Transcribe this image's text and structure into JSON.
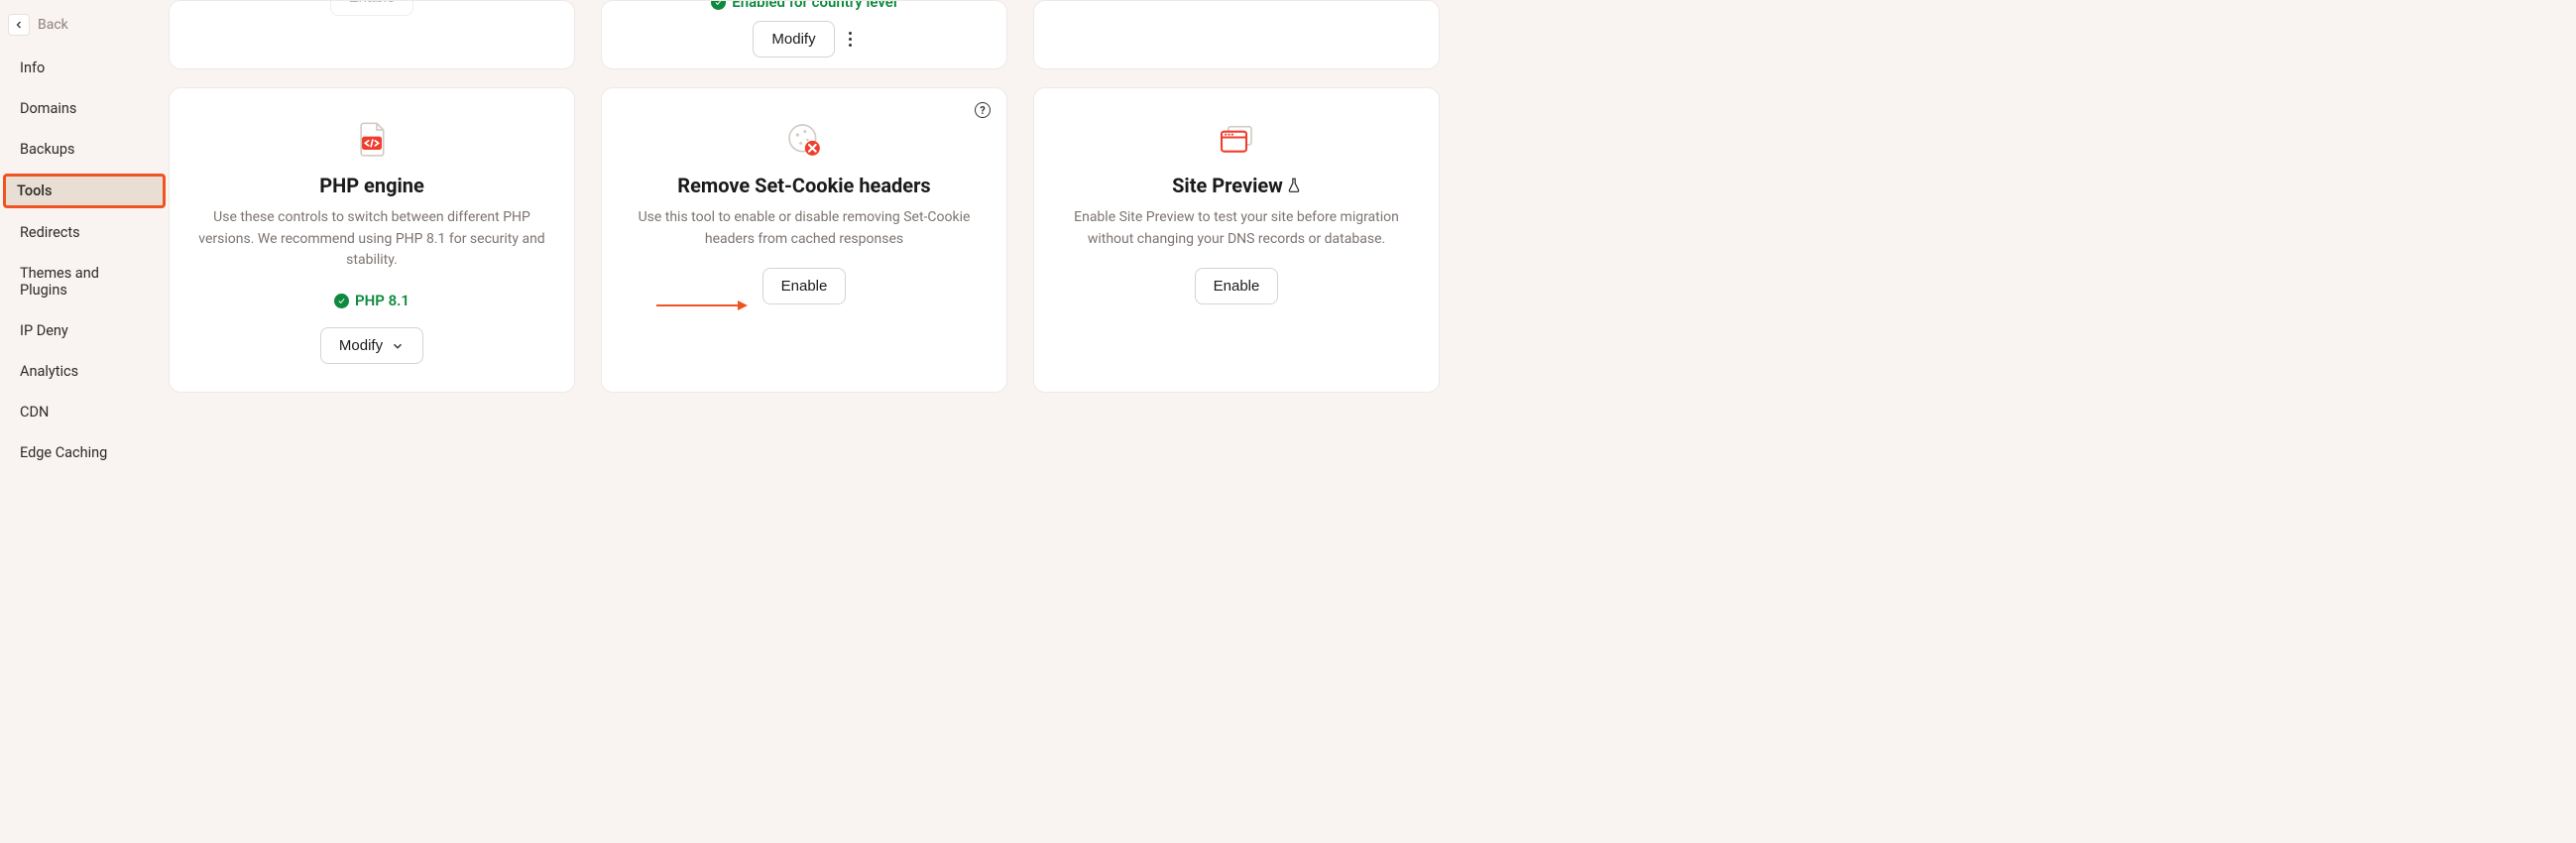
{
  "back": {
    "label": "Back"
  },
  "sidebar": {
    "items": [
      {
        "label": "Info"
      },
      {
        "label": "Domains"
      },
      {
        "label": "Backups"
      },
      {
        "label": "Tools",
        "active": true
      },
      {
        "label": "Redirects"
      },
      {
        "label": "Themes and Plugins"
      },
      {
        "label": "IP Deny"
      },
      {
        "label": "Analytics"
      },
      {
        "label": "CDN"
      },
      {
        "label": "Edge Caching"
      }
    ]
  },
  "top_row": {
    "card1": {
      "button": "Enable"
    },
    "card2": {
      "status": "Enabled for country level",
      "button": "Modify"
    },
    "card3": {}
  },
  "cards": {
    "php": {
      "title": "PHP engine",
      "desc": "Use these controls to switch between different PHP versions. We recommend using PHP 8.1 for security and stability.",
      "status": "PHP 8.1",
      "button": "Modify"
    },
    "cookie": {
      "title": "Remove Set-Cookie headers",
      "desc": "Use this tool to enable or disable removing Set-Cookie headers from cached responses",
      "button": "Enable"
    },
    "preview": {
      "title": "Site Preview",
      "desc": "Enable Site Preview to test your site before migration without changing your DNS records or database.",
      "button": "Enable"
    }
  }
}
